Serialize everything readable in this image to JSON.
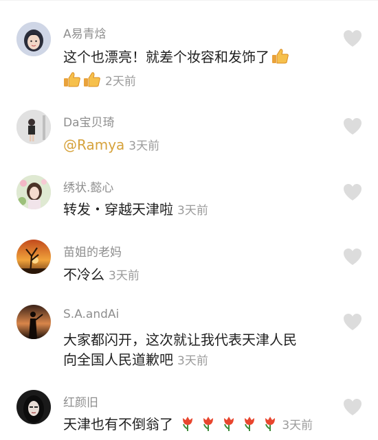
{
  "comments": [
    {
      "username": "A易青焓",
      "line1": "这个也漂亮！就差个妆容和发饰了",
      "time": "2天前",
      "avatar": "woman-portrait-avatar"
    },
    {
      "username": "Da宝贝琦",
      "mention": "@Ramya",
      "time": "3天前",
      "avatar": "girl-standing-avatar"
    },
    {
      "username": "绣状.懿心",
      "line1": "转发・穿越天津啦",
      "time": "3天前",
      "avatar": "girl-flowers-avatar"
    },
    {
      "username": "苗姐的老妈",
      "line1": "不冷么",
      "time": "3天前",
      "avatar": "sunset-tree-avatar"
    },
    {
      "username": "S.A.andAi",
      "line1": "大家都闪开，这次就让我代表天津人民",
      "line2": "向全国人民道歉吧",
      "time": "3天前",
      "avatar": "silhouette-sunset-avatar"
    },
    {
      "username": "红颜旧",
      "line1": "天津也有不倒翁了",
      "time": "3天前",
      "avatar": "dark-hair-portrait-avatar"
    }
  ],
  "colors": {
    "username": "#8e8e8e",
    "text": "#1f1f1f",
    "time": "#9b9b9b",
    "mention": "#d6a23b",
    "heart": "#dcdcdc"
  }
}
